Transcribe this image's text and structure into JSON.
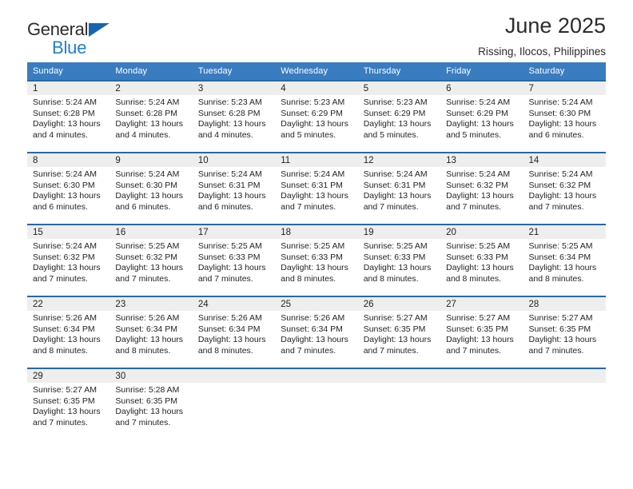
{
  "brand": {
    "line1": "General",
    "line2": "Blue",
    "triangle_color": "#1565b0",
    "text_color": "#2b2b2b",
    "blue_text_color": "#1f7fd0",
    "icon": "triangle-logo-icon"
  },
  "header": {
    "title": "June 2025",
    "subtitle": "Rissing, Ilocos, Philippines"
  },
  "theme": {
    "header_blue": "#3a7cc0",
    "row_border_blue": "#2767ad",
    "daynum_band": "#eeeeee",
    "text": "#231f20"
  },
  "weekdays": [
    "Sunday",
    "Monday",
    "Tuesday",
    "Wednesday",
    "Thursday",
    "Friday",
    "Saturday"
  ],
  "weeks": [
    [
      {
        "day": "1",
        "sunrise": "Sunrise: 5:24 AM",
        "sunset": "Sunset: 6:28 PM",
        "daylight1": "Daylight: 13 hours",
        "daylight2": "and 4 minutes."
      },
      {
        "day": "2",
        "sunrise": "Sunrise: 5:24 AM",
        "sunset": "Sunset: 6:28 PM",
        "daylight1": "Daylight: 13 hours",
        "daylight2": "and 4 minutes."
      },
      {
        "day": "3",
        "sunrise": "Sunrise: 5:23 AM",
        "sunset": "Sunset: 6:28 PM",
        "daylight1": "Daylight: 13 hours",
        "daylight2": "and 4 minutes."
      },
      {
        "day": "4",
        "sunrise": "Sunrise: 5:23 AM",
        "sunset": "Sunset: 6:29 PM",
        "daylight1": "Daylight: 13 hours",
        "daylight2": "and 5 minutes."
      },
      {
        "day": "5",
        "sunrise": "Sunrise: 5:23 AM",
        "sunset": "Sunset: 6:29 PM",
        "daylight1": "Daylight: 13 hours",
        "daylight2": "and 5 minutes."
      },
      {
        "day": "6",
        "sunrise": "Sunrise: 5:24 AM",
        "sunset": "Sunset: 6:29 PM",
        "daylight1": "Daylight: 13 hours",
        "daylight2": "and 5 minutes."
      },
      {
        "day": "7",
        "sunrise": "Sunrise: 5:24 AM",
        "sunset": "Sunset: 6:30 PM",
        "daylight1": "Daylight: 13 hours",
        "daylight2": "and 6 minutes."
      }
    ],
    [
      {
        "day": "8",
        "sunrise": "Sunrise: 5:24 AM",
        "sunset": "Sunset: 6:30 PM",
        "daylight1": "Daylight: 13 hours",
        "daylight2": "and 6 minutes."
      },
      {
        "day": "9",
        "sunrise": "Sunrise: 5:24 AM",
        "sunset": "Sunset: 6:30 PM",
        "daylight1": "Daylight: 13 hours",
        "daylight2": "and 6 minutes."
      },
      {
        "day": "10",
        "sunrise": "Sunrise: 5:24 AM",
        "sunset": "Sunset: 6:31 PM",
        "daylight1": "Daylight: 13 hours",
        "daylight2": "and 6 minutes."
      },
      {
        "day": "11",
        "sunrise": "Sunrise: 5:24 AM",
        "sunset": "Sunset: 6:31 PM",
        "daylight1": "Daylight: 13 hours",
        "daylight2": "and 7 minutes."
      },
      {
        "day": "12",
        "sunrise": "Sunrise: 5:24 AM",
        "sunset": "Sunset: 6:31 PM",
        "daylight1": "Daylight: 13 hours",
        "daylight2": "and 7 minutes."
      },
      {
        "day": "13",
        "sunrise": "Sunrise: 5:24 AM",
        "sunset": "Sunset: 6:32 PM",
        "daylight1": "Daylight: 13 hours",
        "daylight2": "and 7 minutes."
      },
      {
        "day": "14",
        "sunrise": "Sunrise: 5:24 AM",
        "sunset": "Sunset: 6:32 PM",
        "daylight1": "Daylight: 13 hours",
        "daylight2": "and 7 minutes."
      }
    ],
    [
      {
        "day": "15",
        "sunrise": "Sunrise: 5:24 AM",
        "sunset": "Sunset: 6:32 PM",
        "daylight1": "Daylight: 13 hours",
        "daylight2": "and 7 minutes."
      },
      {
        "day": "16",
        "sunrise": "Sunrise: 5:25 AM",
        "sunset": "Sunset: 6:32 PM",
        "daylight1": "Daylight: 13 hours",
        "daylight2": "and 7 minutes."
      },
      {
        "day": "17",
        "sunrise": "Sunrise: 5:25 AM",
        "sunset": "Sunset: 6:33 PM",
        "daylight1": "Daylight: 13 hours",
        "daylight2": "and 7 minutes."
      },
      {
        "day": "18",
        "sunrise": "Sunrise: 5:25 AM",
        "sunset": "Sunset: 6:33 PM",
        "daylight1": "Daylight: 13 hours",
        "daylight2": "and 8 minutes."
      },
      {
        "day": "19",
        "sunrise": "Sunrise: 5:25 AM",
        "sunset": "Sunset: 6:33 PM",
        "daylight1": "Daylight: 13 hours",
        "daylight2": "and 8 minutes."
      },
      {
        "day": "20",
        "sunrise": "Sunrise: 5:25 AM",
        "sunset": "Sunset: 6:33 PM",
        "daylight1": "Daylight: 13 hours",
        "daylight2": "and 8 minutes."
      },
      {
        "day": "21",
        "sunrise": "Sunrise: 5:25 AM",
        "sunset": "Sunset: 6:34 PM",
        "daylight1": "Daylight: 13 hours",
        "daylight2": "and 8 minutes."
      }
    ],
    [
      {
        "day": "22",
        "sunrise": "Sunrise: 5:26 AM",
        "sunset": "Sunset: 6:34 PM",
        "daylight1": "Daylight: 13 hours",
        "daylight2": "and 8 minutes."
      },
      {
        "day": "23",
        "sunrise": "Sunrise: 5:26 AM",
        "sunset": "Sunset: 6:34 PM",
        "daylight1": "Daylight: 13 hours",
        "daylight2": "and 8 minutes."
      },
      {
        "day": "24",
        "sunrise": "Sunrise: 5:26 AM",
        "sunset": "Sunset: 6:34 PM",
        "daylight1": "Daylight: 13 hours",
        "daylight2": "and 8 minutes."
      },
      {
        "day": "25",
        "sunrise": "Sunrise: 5:26 AM",
        "sunset": "Sunset: 6:34 PM",
        "daylight1": "Daylight: 13 hours",
        "daylight2": "and 7 minutes."
      },
      {
        "day": "26",
        "sunrise": "Sunrise: 5:27 AM",
        "sunset": "Sunset: 6:35 PM",
        "daylight1": "Daylight: 13 hours",
        "daylight2": "and 7 minutes."
      },
      {
        "day": "27",
        "sunrise": "Sunrise: 5:27 AM",
        "sunset": "Sunset: 6:35 PM",
        "daylight1": "Daylight: 13 hours",
        "daylight2": "and 7 minutes."
      },
      {
        "day": "28",
        "sunrise": "Sunrise: 5:27 AM",
        "sunset": "Sunset: 6:35 PM",
        "daylight1": "Daylight: 13 hours",
        "daylight2": "and 7 minutes."
      }
    ],
    [
      {
        "day": "29",
        "sunrise": "Sunrise: 5:27 AM",
        "sunset": "Sunset: 6:35 PM",
        "daylight1": "Daylight: 13 hours",
        "daylight2": "and 7 minutes."
      },
      {
        "day": "30",
        "sunrise": "Sunrise: 5:28 AM",
        "sunset": "Sunset: 6:35 PM",
        "daylight1": "Daylight: 13 hours",
        "daylight2": "and 7 minutes."
      },
      {
        "day": "",
        "sunrise": "",
        "sunset": "",
        "daylight1": "",
        "daylight2": ""
      },
      {
        "day": "",
        "sunrise": "",
        "sunset": "",
        "daylight1": "",
        "daylight2": ""
      },
      {
        "day": "",
        "sunrise": "",
        "sunset": "",
        "daylight1": "",
        "daylight2": ""
      },
      {
        "day": "",
        "sunrise": "",
        "sunset": "",
        "daylight1": "",
        "daylight2": ""
      },
      {
        "day": "",
        "sunrise": "",
        "sunset": "",
        "daylight1": "",
        "daylight2": ""
      }
    ]
  ]
}
